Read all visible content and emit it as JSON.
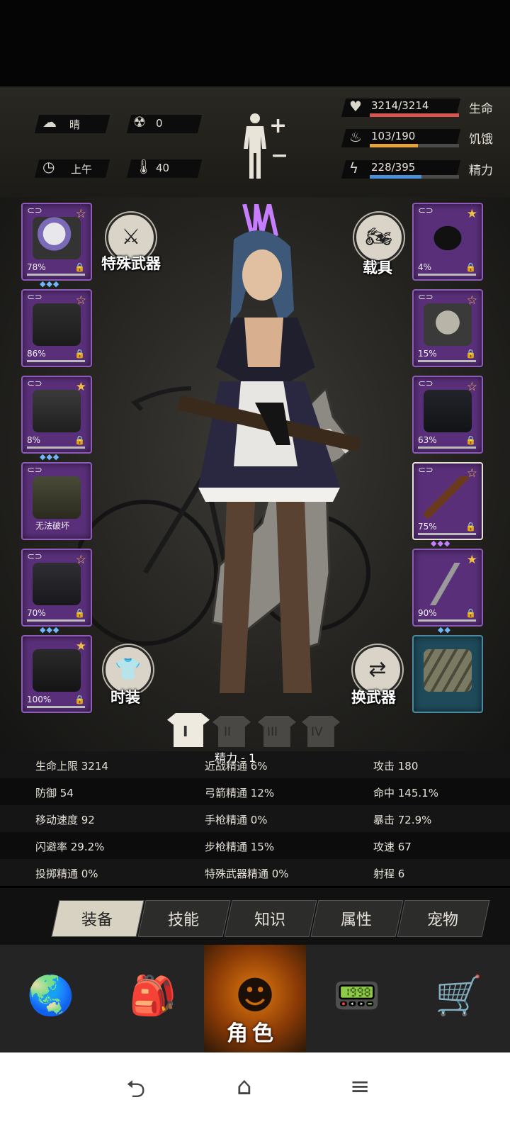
{
  "status_panel": {
    "weather": {
      "icon": "cloud-sun-icon",
      "label": "晴"
    },
    "radiation": {
      "icon": "radiation-icon",
      "value": "0"
    },
    "time": {
      "icon": "clock-icon",
      "label": "上午"
    },
    "temperature": {
      "icon": "thermometer-icon",
      "value": "40"
    },
    "body_plus": "+",
    "body_minus": "−",
    "vitals": [
      {
        "icon": "heart-icon",
        "value": "3214/3214",
        "label": "生命",
        "fill": 1.0,
        "color": "#d9534f"
      },
      {
        "icon": "stomach-icon",
        "value": "103/190",
        "label": "饥饿",
        "fill": 0.54,
        "color": "#e8a23b"
      },
      {
        "icon": "lightning-icon",
        "value": "228/395",
        "label": "精力",
        "fill": 0.58,
        "color": "#4a90d9"
      }
    ]
  },
  "left_slots": [
    {
      "item": "police-helmet",
      "pct": "78%",
      "star": "☆",
      "gems": "◆◆◆",
      "link": "⊂⊃",
      "lock": "🔒"
    },
    {
      "item": "jacket",
      "pct": "86%",
      "star": "☆",
      "gems": "",
      "link": "⊂⊃",
      "lock": "🔒"
    },
    {
      "item": "leather-jacket",
      "pct": "8%",
      "star": "★",
      "gems": "◆◆◆",
      "link": "⊂⊃",
      "lock": "🔒"
    },
    {
      "item": "backpack",
      "pct": "无法破坏",
      "star": "",
      "gems": "",
      "link": "⊂⊃",
      "lock": ""
    },
    {
      "item": "pants",
      "pct": "70%",
      "star": "☆",
      "gems": "◆◆◆",
      "link": "⊂⊃",
      "lock": "🔒"
    },
    {
      "item": "boots",
      "pct": "100%",
      "star": "★",
      "gems": "",
      "link": "",
      "lock": "🔒"
    }
  ],
  "right_slots": [
    {
      "item": "goggles",
      "pct": "4%",
      "star": "★",
      "gems": "",
      "link": "⊂⊃",
      "lock": "🔒"
    },
    {
      "item": "gas-mask",
      "pct": "15%",
      "star": "☆",
      "gems": "",
      "link": "⊂⊃",
      "lock": "🔒"
    },
    {
      "item": "police-vest",
      "pct": "63%",
      "star": "☆",
      "gems": "",
      "link": "⊂⊃",
      "lock": "🔒"
    },
    {
      "item": "assault-rifle",
      "pct": "75%",
      "star": "☆",
      "gems": "◆◆◆",
      "link": "⊂⊃",
      "lock": "🔒"
    },
    {
      "item": "machete",
      "pct": "90%",
      "star": "★",
      "gems": "◆◆",
      "link": "",
      "lock": "🔒"
    },
    {
      "item": "dynamite",
      "pct": "",
      "star": "",
      "gems": "",
      "link": "",
      "lock": ""
    }
  ],
  "buttons": {
    "special_weapon": "特殊武器",
    "vehicle": "载具",
    "fashion": "时装",
    "swap_weapon": "换武器"
  },
  "outfit_sets": [
    "I",
    "II",
    "III",
    "IV"
  ],
  "stamina_note": "精力 - 1",
  "stats": [
    [
      "生命上限 3214",
      "近战精通 6%",
      "攻击 180"
    ],
    [
      "防御 54",
      "弓箭精通 12%",
      "命中 145.1%"
    ],
    [
      "移动速度 92",
      "手枪精通 0%",
      "暴击 72.9%"
    ],
    [
      "闪避率 29.2%",
      "步枪精通 15%",
      "攻速 67"
    ],
    [
      "投掷精通 0%",
      "特殊武器精通 0%",
      "射程 6"
    ]
  ],
  "tabs": [
    "装备",
    "技能",
    "知识",
    "属性",
    "宠物"
  ],
  "active_tab": 0,
  "bottom_nav": [
    {
      "icon": "globe-icon",
      "label": ""
    },
    {
      "icon": "backpack-icon",
      "label": ""
    },
    {
      "icon": "character-head-icon",
      "label": "角色"
    },
    {
      "icon": "radio-icon",
      "label": ""
    },
    {
      "icon": "cart-icon",
      "label": ""
    }
  ],
  "system_nav": [
    "back-icon",
    "home-icon",
    "menu-icon"
  ]
}
